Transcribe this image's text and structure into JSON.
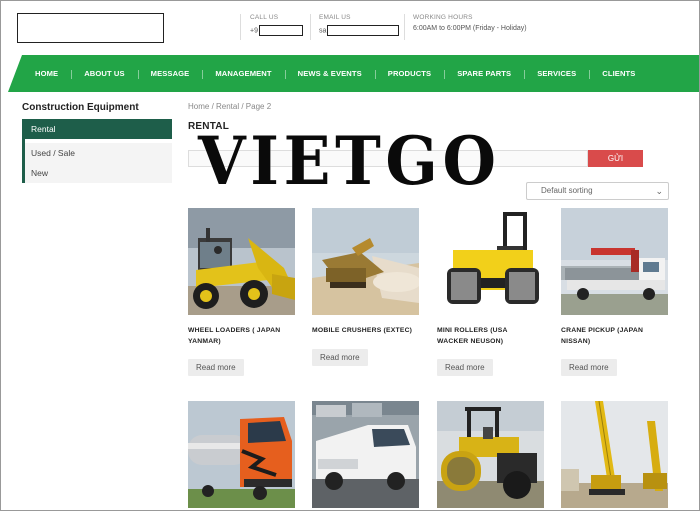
{
  "header": {
    "call_label": "CALL US",
    "call_value": "+9",
    "email_label": "EMAIL US",
    "email_value": "sa",
    "hours_label": "WORKING HOURS",
    "hours_value": "6:00AM to 6:00PM (Friday - Holiday)"
  },
  "nav": {
    "items": [
      "HOME",
      "ABOUT US",
      "MESSAGE",
      "MANAGEMENT",
      "NEWS & EVENTS",
      "PRODUCTS",
      "SPARE PARTS",
      "SERVICES",
      "CLIENTS"
    ]
  },
  "sidebar": {
    "title": "Construction Equipment",
    "items": [
      "Rental",
      "Used / Sale",
      "New"
    ]
  },
  "breadcrumb": "Home / Rental / Page 2",
  "page_title": "RENTAL",
  "search": {
    "button_label": "GỬI"
  },
  "sort": {
    "selected": "Default sorting"
  },
  "watermark": "VIETGO",
  "products": [
    {
      "name_line1": "WHEEL LOADERS ( JAPAN",
      "name_line2": "YANMAR)",
      "more": "Read more"
    },
    {
      "name_line1": "MOBILE CRUSHERS (EXTEC)",
      "name_line2": "",
      "more": "Read more"
    },
    {
      "name_line1": "MINI ROLLERS (USA",
      "name_line2": "WACKER NEUSON)",
      "more": "Read more"
    },
    {
      "name_line1": "CRANE PICKUP (JAPAN",
      "name_line2": "NISSAN)",
      "more": "Read more"
    }
  ],
  "colors": {
    "nav_green": "#22a547",
    "sidebar_active": "#1e5e4a",
    "search_button": "#d94b4b"
  }
}
